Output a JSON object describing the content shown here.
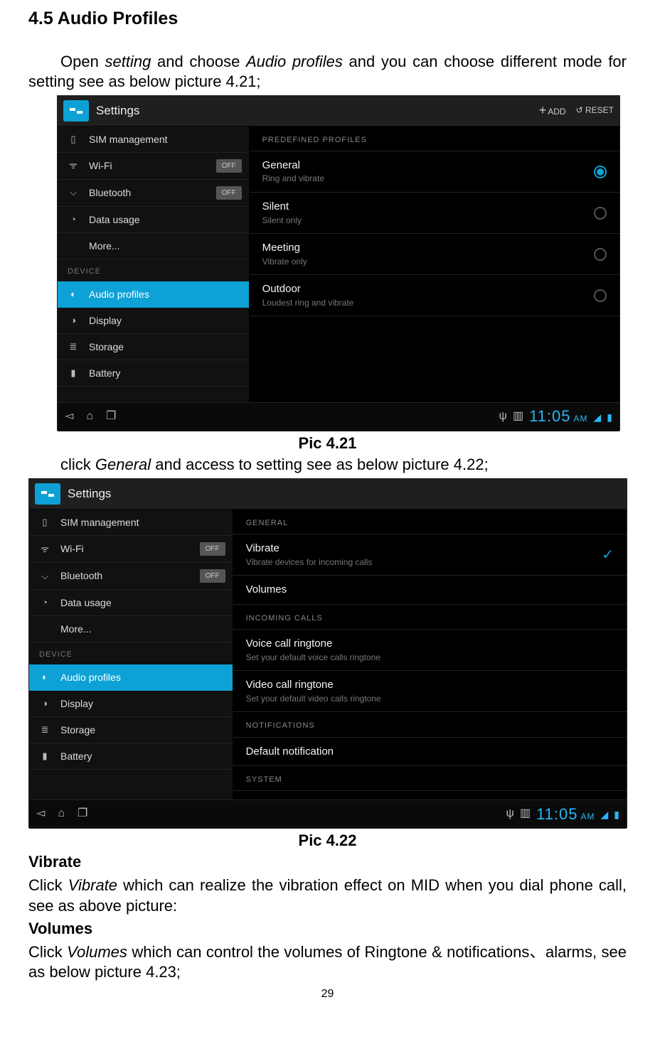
{
  "doc": {
    "section_title": "4.5 Audio Profiles",
    "intro_a": "Open ",
    "intro_b": "setting",
    "intro_c": " and choose ",
    "intro_d": "Audio profiles",
    "intro_e": " and you can choose different mode for setting see as below picture 4.21;",
    "caption1": "Pic 4.21",
    "between_a": "click ",
    "between_b": "General",
    "between_c": " and access to setting see as below picture 4.22;",
    "caption2": "Pic 4.22",
    "vibrate_head": "Vibrate",
    "vibrate_a": "Click ",
    "vibrate_b": "Vibrate",
    "vibrate_c": " which can realize the vibration effect on MID when you dial phone call, see as above picture:",
    "volumes_head": "Volumes",
    "volumes_a": "Click ",
    "volumes_b": "Volumes",
    "volumes_c": " which can control the volumes of  Ringtone & notifications、alarms, see as below picture 4.23;",
    "page_num": "29"
  },
  "ss_common": {
    "settings": "Settings",
    "add": "ADD",
    "reset": "RESET",
    "off": "OFF",
    "device": "DEVICE",
    "side": {
      "sim": "SIM management",
      "wifi": "Wi-Fi",
      "bt": "Bluetooth",
      "data": "Data usage",
      "more": "More...",
      "audio": "Audio profiles",
      "display": "Display",
      "storage": "Storage",
      "battery": "Battery"
    },
    "clock": "11:05",
    "ampm": "AM"
  },
  "ss1": {
    "head": "PREDEFINED PROFILES",
    "p": [
      {
        "t": "General",
        "s": "Ring and vibrate"
      },
      {
        "t": "Silent",
        "s": "Silent only"
      },
      {
        "t": "Meeting",
        "s": "Vibrate only"
      },
      {
        "t": "Outdoor",
        "s": "Loudest ring and vibrate"
      }
    ]
  },
  "ss2": {
    "h_general": "GENERAL",
    "h_incoming": "INCOMING CALLS",
    "h_notif": "NOTIFICATIONS",
    "h_system": "SYSTEM",
    "r": {
      "vib_t": "Vibrate",
      "vib_s": "Vibrate devices for incoming calls",
      "vol_t": "Volumes",
      "voice_t": "Voice call ringtone",
      "voice_s": "Set your default voice calls ringtone",
      "video_t": "Video call ringtone",
      "video_s": "Set your default video calls ringtone",
      "def_t": "Default notification"
    }
  }
}
